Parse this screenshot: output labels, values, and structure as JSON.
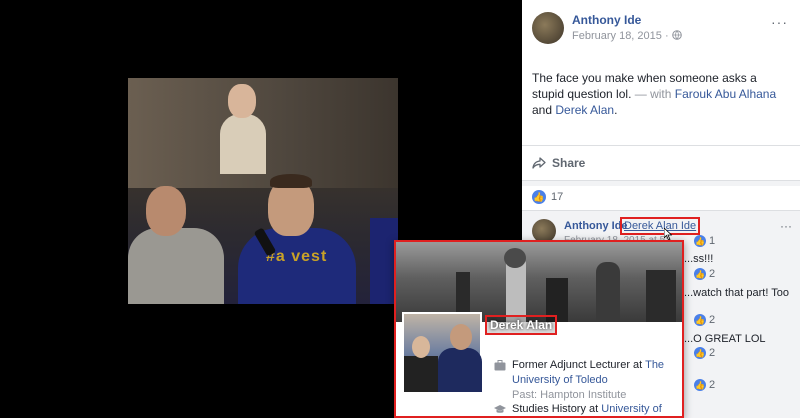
{
  "post": {
    "author": "Anthony Ide",
    "date": "February 18, 2015",
    "separator": " · ",
    "privacy_icon": "globe-icon",
    "menu": "···",
    "text_main": "The face you make when someone asks a stupid question lol.",
    "text_with": " — with ",
    "tag1": "Farouk Abu Alhana",
    "text_and": " and ",
    "tag2": "Derek Alan",
    "text_end": "."
  },
  "actions": {
    "share_label": "Share"
  },
  "reactions": {
    "count": "17"
  },
  "comment": {
    "author": "Anthony Ide",
    "mention": "Derek Alan Ide",
    "date_partial": "February 18, 2015 at 5:...",
    "menu": "···",
    "lines": [
      "...ss!!!",
      "...watch that part! Too",
      "...O GREAT LOL"
    ],
    "react_counts": [
      "1",
      "2",
      "2",
      "2",
      "2"
    ]
  },
  "hovercard": {
    "name": "Derek Alan",
    "work_line1": "Former Adjunct Lecturer at ",
    "work_org": "The University of Toledo",
    "work_past": "Past: Hampton Institute",
    "study_line": "Studies History at ",
    "study_org": "University of"
  },
  "colors": {
    "link": "#365899",
    "highlight": "#e02020",
    "panel_bg": "#ffffff"
  }
}
